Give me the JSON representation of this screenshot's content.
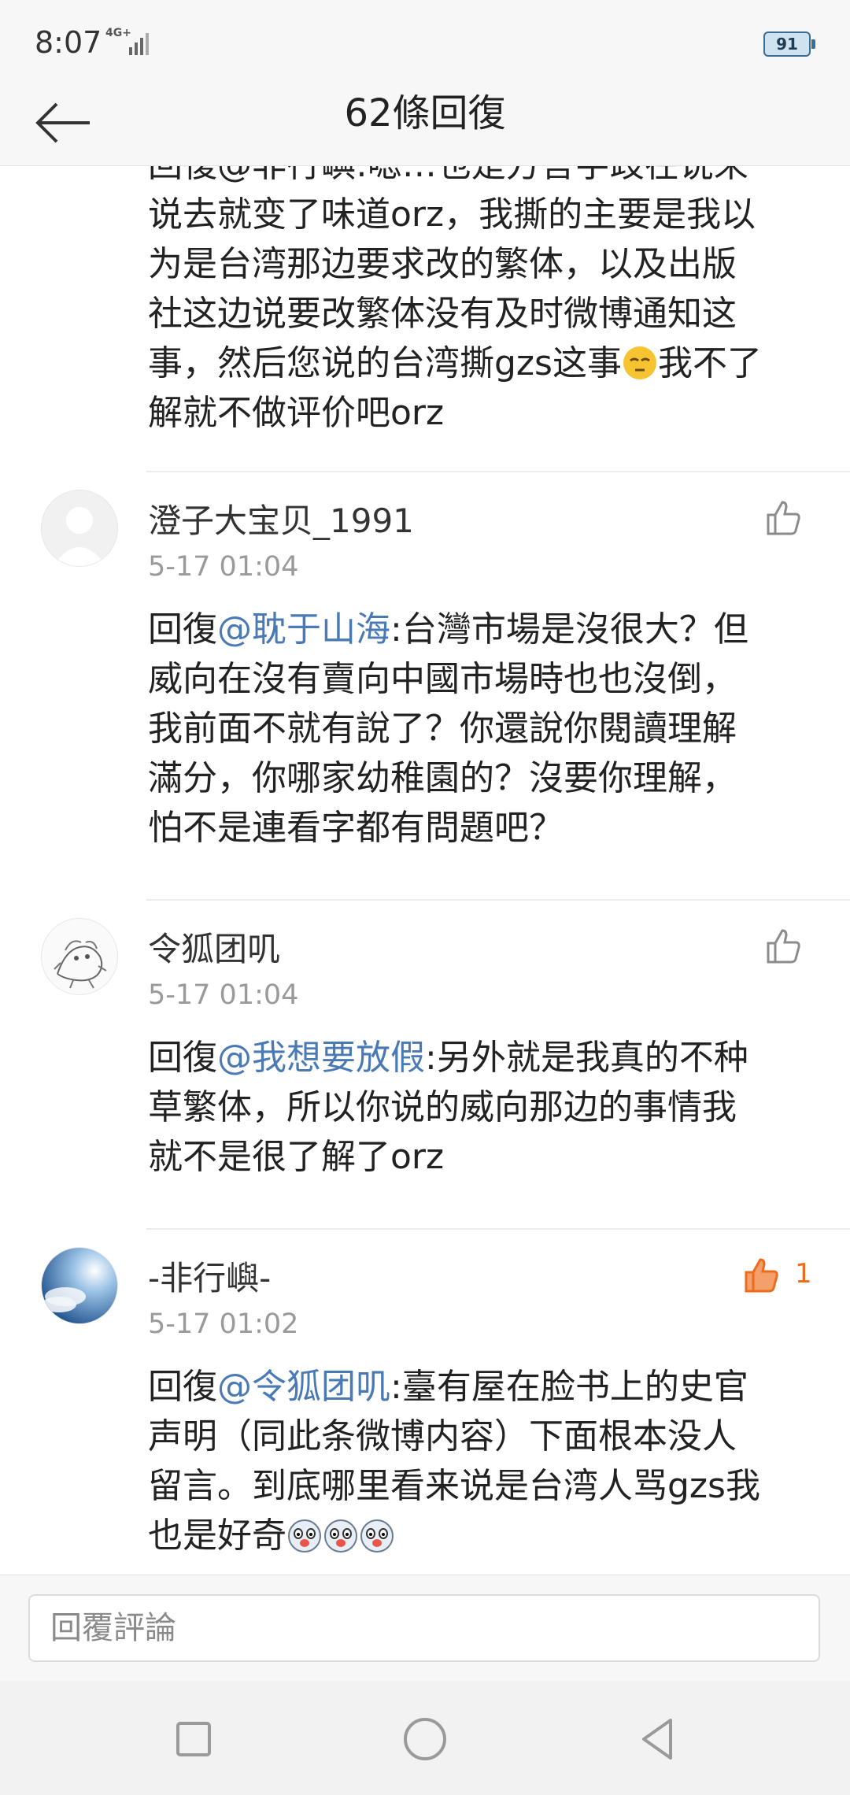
{
  "status_bar": {
    "time": "8:07",
    "network": "4G+",
    "battery": "91"
  },
  "header": {
    "title": "62條回復"
  },
  "partial_comment": {
    "lines": [
      "回復@非行嶼:嗯…也是方言字歧在说来",
      "说去就变了味道orz，我撕的主要是我以",
      "为是台湾那边要求改的繁体，以及出版",
      "社这边说要改繁体没有及时微博通知这",
      "事，然后您说的台湾撕gzs这事",
      "我不了",
      "解就不做评价吧orz"
    ]
  },
  "comments": [
    {
      "username": "澄子大宝贝_1991",
      "time": "5-17 01:04",
      "reply_prefix": "回復",
      "mention": "@耽于山海",
      "text_lines": [
        ":台灣市場是沒很大？但",
        "威向在沒有賣向中國市場時也也沒倒，",
        "我前面不就有說了？你還說你閱讀理解",
        "滿分，你哪家幼稚園的？沒要你理解，",
        "怕不是連看字都有問題吧？"
      ],
      "likes": ""
    },
    {
      "username": "令狐团叽",
      "time": "5-17 01:04",
      "reply_prefix": "回復",
      "mention": "@我想要放假",
      "text_lines": [
        ":另外就是我真的不种",
        "草繁体，所以你说的威向那边的事情我",
        "就不是很了解了orz"
      ],
      "likes": ""
    },
    {
      "username": "-非行嶼-",
      "time": "5-17 01:02",
      "reply_prefix": "回復",
      "mention": "@令狐团叽",
      "text_lines": [
        ":臺有屋在脸书上的史官",
        "声明（同此条微博内容）下面根本没人",
        "留言。到底哪里看来说是台湾人骂gzs我",
        "也是好奇"
      ],
      "likes": "1"
    }
  ],
  "reply_bar": {
    "placeholder": "回覆評論"
  },
  "colors": {
    "mention": "#4a7ab6",
    "liked": "#f06a1c",
    "meta": "#9a9a9a"
  },
  "icons": [
    "back-arrow-icon",
    "thumb-up-icon",
    "square-nav-icon",
    "circle-nav-icon",
    "triangle-nav-icon"
  ]
}
